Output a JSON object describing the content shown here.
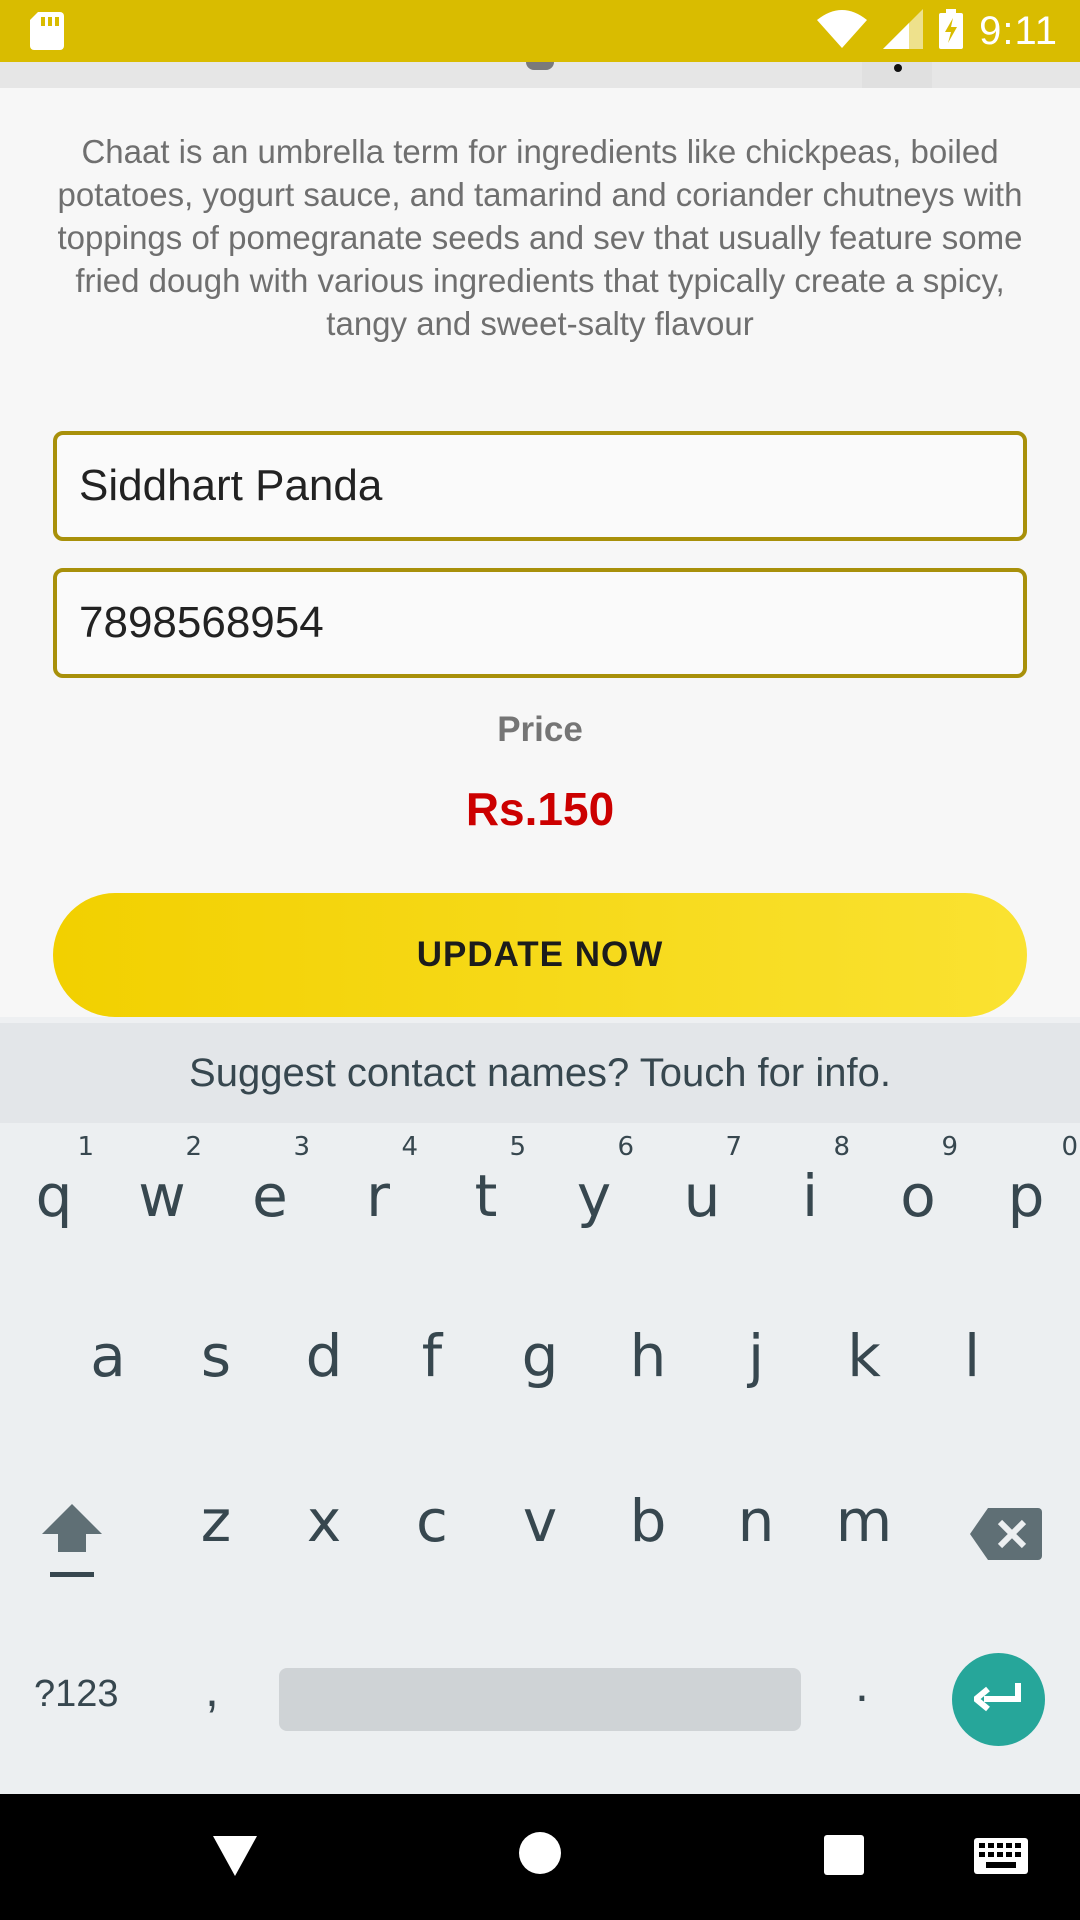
{
  "status_bar": {
    "time": "9:11",
    "icons": [
      "sd-card-icon",
      "wifi-icon",
      "signal-icon",
      "battery-charging-icon"
    ],
    "color": "#d9bc00"
  },
  "content": {
    "description": "Chaat is an umbrella term for ingredients like chickpeas, boiled potatoes, yogurt sauce, and tamarind and coriander chutneys with toppings of pomegranate seeds and sev  that usually feature some fried dough with various ingredients that typically create a spicy, tangy and sweet-salty flavour",
    "name_value": "Siddhart Panda",
    "phone_value": "7898568954",
    "price_label": "Price",
    "price_value": "Rs.150",
    "update_button": "UPDATE NOW",
    "accent_color": "#cc0000",
    "button_color": "#f2d000"
  },
  "keyboard": {
    "suggestion": "Suggest contact names? Touch for info.",
    "row1": [
      {
        "key": "q",
        "hint": "1"
      },
      {
        "key": "w",
        "hint": "2"
      },
      {
        "key": "e",
        "hint": "3"
      },
      {
        "key": "r",
        "hint": "4"
      },
      {
        "key": "t",
        "hint": "5"
      },
      {
        "key": "y",
        "hint": "6"
      },
      {
        "key": "u",
        "hint": "7"
      },
      {
        "key": "i",
        "hint": "8"
      },
      {
        "key": "o",
        "hint": "9"
      },
      {
        "key": "p",
        "hint": "0"
      }
    ],
    "row2": [
      "a",
      "s",
      "d",
      "f",
      "g",
      "h",
      "j",
      "k",
      "l"
    ],
    "row3": [
      "z",
      "x",
      "c",
      "v",
      "b",
      "n",
      "m"
    ],
    "symbols_key": "?123",
    "comma_key": ",",
    "period_key": ".",
    "enter_color": "#26a69a"
  },
  "nav_bar": {
    "icons": [
      "back-icon",
      "home-icon",
      "recents-icon",
      "keyboard-switch-icon"
    ]
  }
}
